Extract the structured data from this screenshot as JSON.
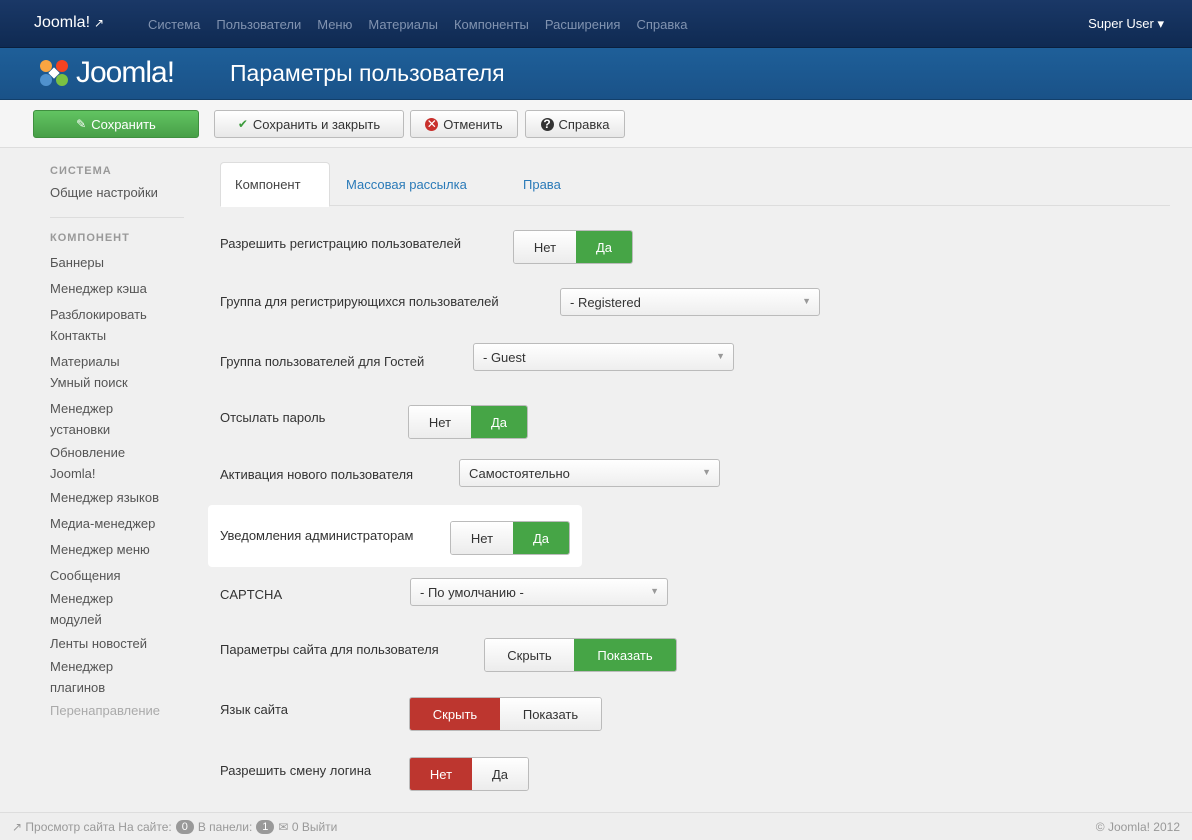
{
  "topbar": {
    "brand": "Joomla!",
    "menu": [
      "Система",
      "Пользователи",
      "Меню",
      "Материалы",
      "Компоненты",
      "Расширения",
      "Справка"
    ],
    "user": "Super User"
  },
  "header": {
    "logo_text": "Joomla!",
    "title": "Параметры пользователя"
  },
  "toolbar": {
    "save": "Сохранить",
    "save_close": "Сохранить и закрыть",
    "cancel": "Отменить",
    "help": "Справка"
  },
  "sidebar": {
    "section_system": "СИСТЕМА",
    "global_config": "Общие настройки",
    "section_component": "КОМПОНЕНТ",
    "items": [
      "Баннеры",
      "Менеджер кэша",
      "Разблокировать",
      "Контакты",
      "Материалы",
      "Умный поиск",
      "Менеджер",
      "установки",
      "Обновление",
      "Joomla!",
      "Менеджер языков",
      "Медиа-менеджер",
      "Менеджер меню",
      "Сообщения",
      "Менеджер",
      "модулей",
      "Ленты новостей",
      "Менеджер",
      "плагинов",
      "Перенаправление"
    ]
  },
  "tabs": [
    "Компонент",
    "Массовая рассылка",
    "Права"
  ],
  "form": {
    "allow_registration": {
      "label": "Разрешить регистрацию пользователей",
      "off": "Нет",
      "on": "Да"
    },
    "new_user_group": {
      "label": "Группа для регистрирующихся пользователей",
      "value": "- Registered"
    },
    "guest_group": {
      "label": "Группа пользователей для Гостей",
      "value": "- Guest"
    },
    "send_password": {
      "label": "Отсылать пароль",
      "off": "Нет",
      "on": "Да"
    },
    "activation": {
      "label": "Активация нового пользователя",
      "value": "Самостоятельно"
    },
    "notify_admins": {
      "label": "Уведомления администраторам",
      "off": "Нет",
      "on": "Да"
    },
    "captcha": {
      "label": "CAPTCHA",
      "value": "- По умолчанию -"
    },
    "frontend_params": {
      "label": "Параметры сайта для пользователя",
      "off": "Скрыть",
      "on": "Показать"
    },
    "site_language": {
      "label": "Язык сайта",
      "off": "Скрыть",
      "on": "Показать"
    },
    "change_login": {
      "label": "Разрешить смену логина",
      "off": "Нет",
      "on": "Да"
    }
  },
  "footer": {
    "view_site": "Просмотр сайта",
    "on_site": "На сайте:",
    "on_site_count": "0",
    "in_panel": "В панели:",
    "in_panel_count": "1",
    "messages": "0",
    "logout": "Выйти",
    "copyright": "© Joomla! 2012"
  },
  "colors": {
    "topbar": "#1a3867",
    "header": "#1e5f99",
    "green": "#46a546",
    "red": "#bd362f",
    "link": "#2a7ab8"
  }
}
